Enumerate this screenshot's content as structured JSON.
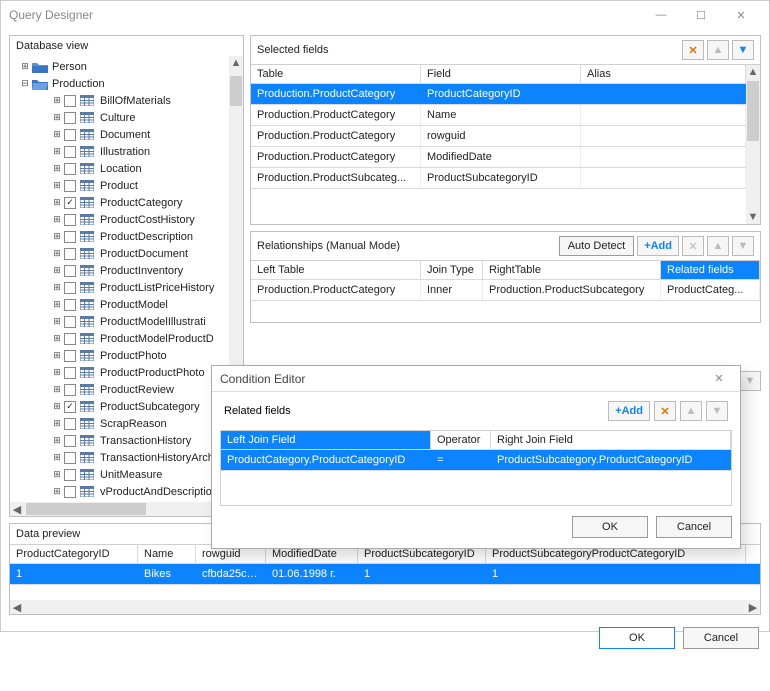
{
  "window": {
    "title": "Query Designer"
  },
  "tree": {
    "title": "Database view",
    "roots": [
      {
        "label": "Person",
        "open": false
      },
      {
        "label": "Production",
        "open": true
      }
    ],
    "production_tables": [
      {
        "label": "BillOfMaterials",
        "checked": false
      },
      {
        "label": "Culture",
        "checked": false
      },
      {
        "label": "Document",
        "checked": false
      },
      {
        "label": "Illustration",
        "checked": false
      },
      {
        "label": "Location",
        "checked": false
      },
      {
        "label": "Product",
        "checked": false
      },
      {
        "label": "ProductCategory",
        "checked": true
      },
      {
        "label": "ProductCostHistory",
        "checked": false
      },
      {
        "label": "ProductDescription",
        "checked": false
      },
      {
        "label": "ProductDocument",
        "checked": false
      },
      {
        "label": "ProductInventory",
        "checked": false
      },
      {
        "label": "ProductListPriceHistory",
        "checked": false
      },
      {
        "label": "ProductModel",
        "checked": false
      },
      {
        "label": "ProductModelIllustrati",
        "checked": false
      },
      {
        "label": "ProductModelProductD",
        "checked": false
      },
      {
        "label": "ProductPhoto",
        "checked": false
      },
      {
        "label": "ProductProductPhoto",
        "checked": false
      },
      {
        "label": "ProductReview",
        "checked": false
      },
      {
        "label": "ProductSubcategory",
        "checked": true
      },
      {
        "label": "ScrapReason",
        "checked": false
      },
      {
        "label": "TransactionHistory",
        "checked": false
      },
      {
        "label": "TransactionHistoryArch",
        "checked": false
      },
      {
        "label": "UnitMeasure",
        "checked": false
      },
      {
        "label": "vProductAndDescriptio",
        "checked": false
      }
    ]
  },
  "selected": {
    "title": "Selected fields",
    "headers": {
      "table": "Table",
      "field": "Field",
      "alias": "Alias"
    },
    "rows": [
      {
        "table": "Production.ProductCategory",
        "field": "ProductCategoryID",
        "alias": "",
        "sel": true
      },
      {
        "table": "Production.ProductCategory",
        "field": "Name",
        "alias": ""
      },
      {
        "table": "Production.ProductCategory",
        "field": "rowguid",
        "alias": ""
      },
      {
        "table": "Production.ProductCategory",
        "field": "ModifiedDate",
        "alias": ""
      },
      {
        "table": "Production.ProductSubcateg...",
        "field": "ProductSubcategoryID",
        "alias": ""
      }
    ]
  },
  "relationships": {
    "title": "Relationships (Manual Mode)",
    "auto": "Auto Detect",
    "add": "+Add",
    "headers": {
      "left": "Left Table",
      "join": "Join Type",
      "right": "RightTable",
      "related": "Related fields"
    },
    "rows": [
      {
        "left": "Production.ProductCategory",
        "join": "Inner",
        "right": "Production.ProductSubcategory",
        "related": "ProductCateg..."
      }
    ]
  },
  "modal": {
    "title": "Condition Editor",
    "section": "Related fields",
    "add": "+Add",
    "headers": {
      "left": "Left Join Field",
      "op": "Operator",
      "right": "Right Join Field"
    },
    "row": {
      "left": "ProductCategory.ProductCategoryID",
      "op": "=",
      "right": "ProductSubcategory.ProductCategoryID"
    },
    "ok": "OK",
    "cancel": "Cancel"
  },
  "preview": {
    "title": "Data preview",
    "headers": [
      "ProductCategoryID",
      "Name",
      "rowguid",
      "ModifiedDate",
      "ProductSubcategoryID",
      "ProductSubcategoryProductCategoryID"
    ],
    "row": [
      "1",
      "Bikes",
      "cfbda25c-...",
      "01.06.1998 г.",
      "1",
      "1"
    ]
  },
  "footer": {
    "ok": "OK",
    "cancel": "Cancel"
  }
}
